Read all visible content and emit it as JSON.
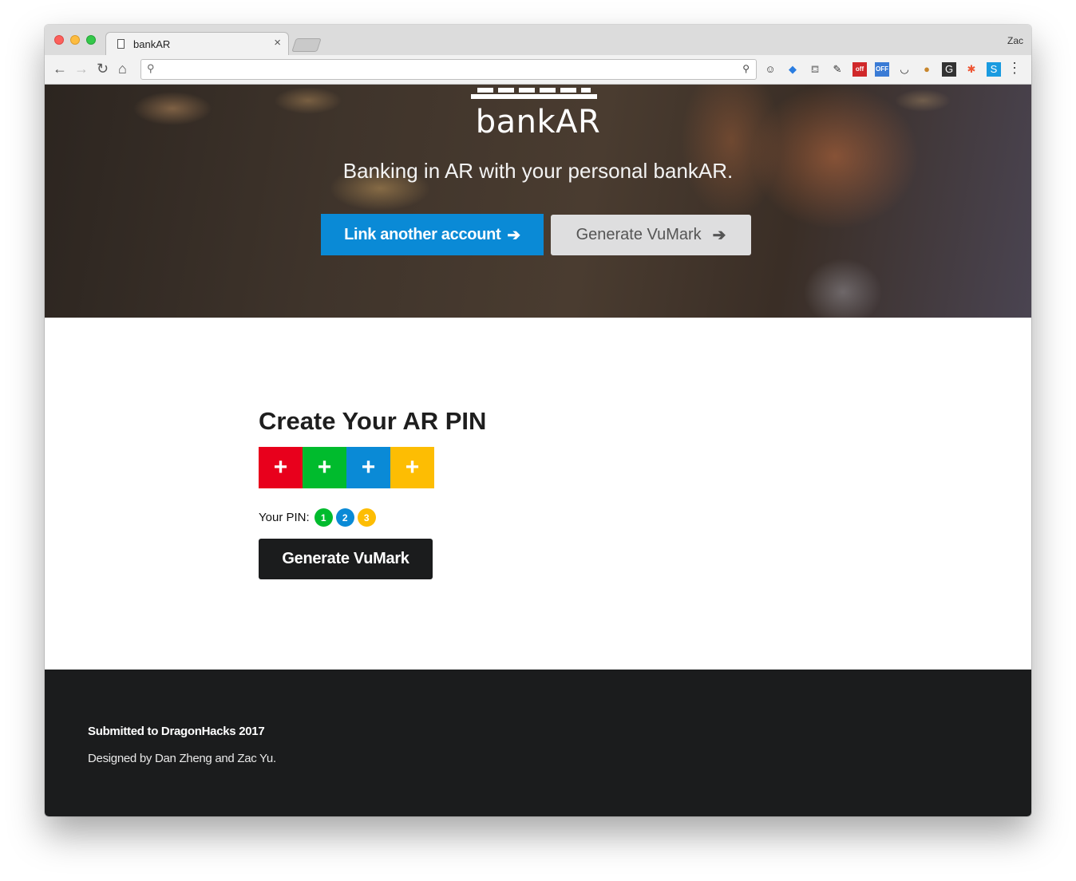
{
  "browser": {
    "tab_title": "bankAR",
    "tab_close": "×",
    "profile_name": "Zac",
    "address_value": "",
    "nav": {
      "back": "←",
      "forward": "→",
      "reload": "↻",
      "home": "⌂"
    },
    "extensions": [
      {
        "icon": "ghostery-icon",
        "glyph": "☺"
      },
      {
        "icon": "extension-blue-icon",
        "glyph": "◆"
      },
      {
        "icon": "paint-bucket-icon",
        "glyph": "⛾"
      },
      {
        "icon": "eyedropper-icon",
        "glyph": "✎"
      },
      {
        "icon": "lock-off-icon",
        "glyph": "off"
      },
      {
        "icon": "speed-off-icon",
        "glyph": "OFF"
      },
      {
        "icon": "smile-icon",
        "glyph": "◡"
      },
      {
        "icon": "cookie-icon",
        "glyph": "●"
      },
      {
        "icon": "grammarly-icon",
        "glyph": "G"
      },
      {
        "icon": "color-wheel-icon",
        "glyph": "✱"
      },
      {
        "icon": "skype-icon",
        "glyph": "S"
      }
    ],
    "menu": "⋮"
  },
  "hero": {
    "logo_text": "bankAR",
    "tagline": "Banking in AR with your personal bankAR.",
    "link_button": "Link another account",
    "generate_button": "Generate VuMark",
    "arrow": "➔"
  },
  "pin": {
    "title": "Create Your AR PIN",
    "tiles": [
      {
        "label": "+",
        "color": "#e8001c"
      },
      {
        "label": "+",
        "color": "#00bb2d"
      },
      {
        "label": "+",
        "color": "#0a8ad6"
      },
      {
        "label": "+",
        "color": "#fdbd03"
      }
    ],
    "your_pin_label": "Your PIN:",
    "digits": [
      {
        "value": "1",
        "color": "#00bb2d"
      },
      {
        "value": "2",
        "color": "#0a8ad6"
      },
      {
        "value": "3",
        "color": "#fdbd03"
      }
    ],
    "generate_button": "Generate VuMark"
  },
  "footer": {
    "submitted": "Submitted to DragonHacks 2017",
    "designed": "Designed by Dan Zheng and Zac Yu."
  }
}
